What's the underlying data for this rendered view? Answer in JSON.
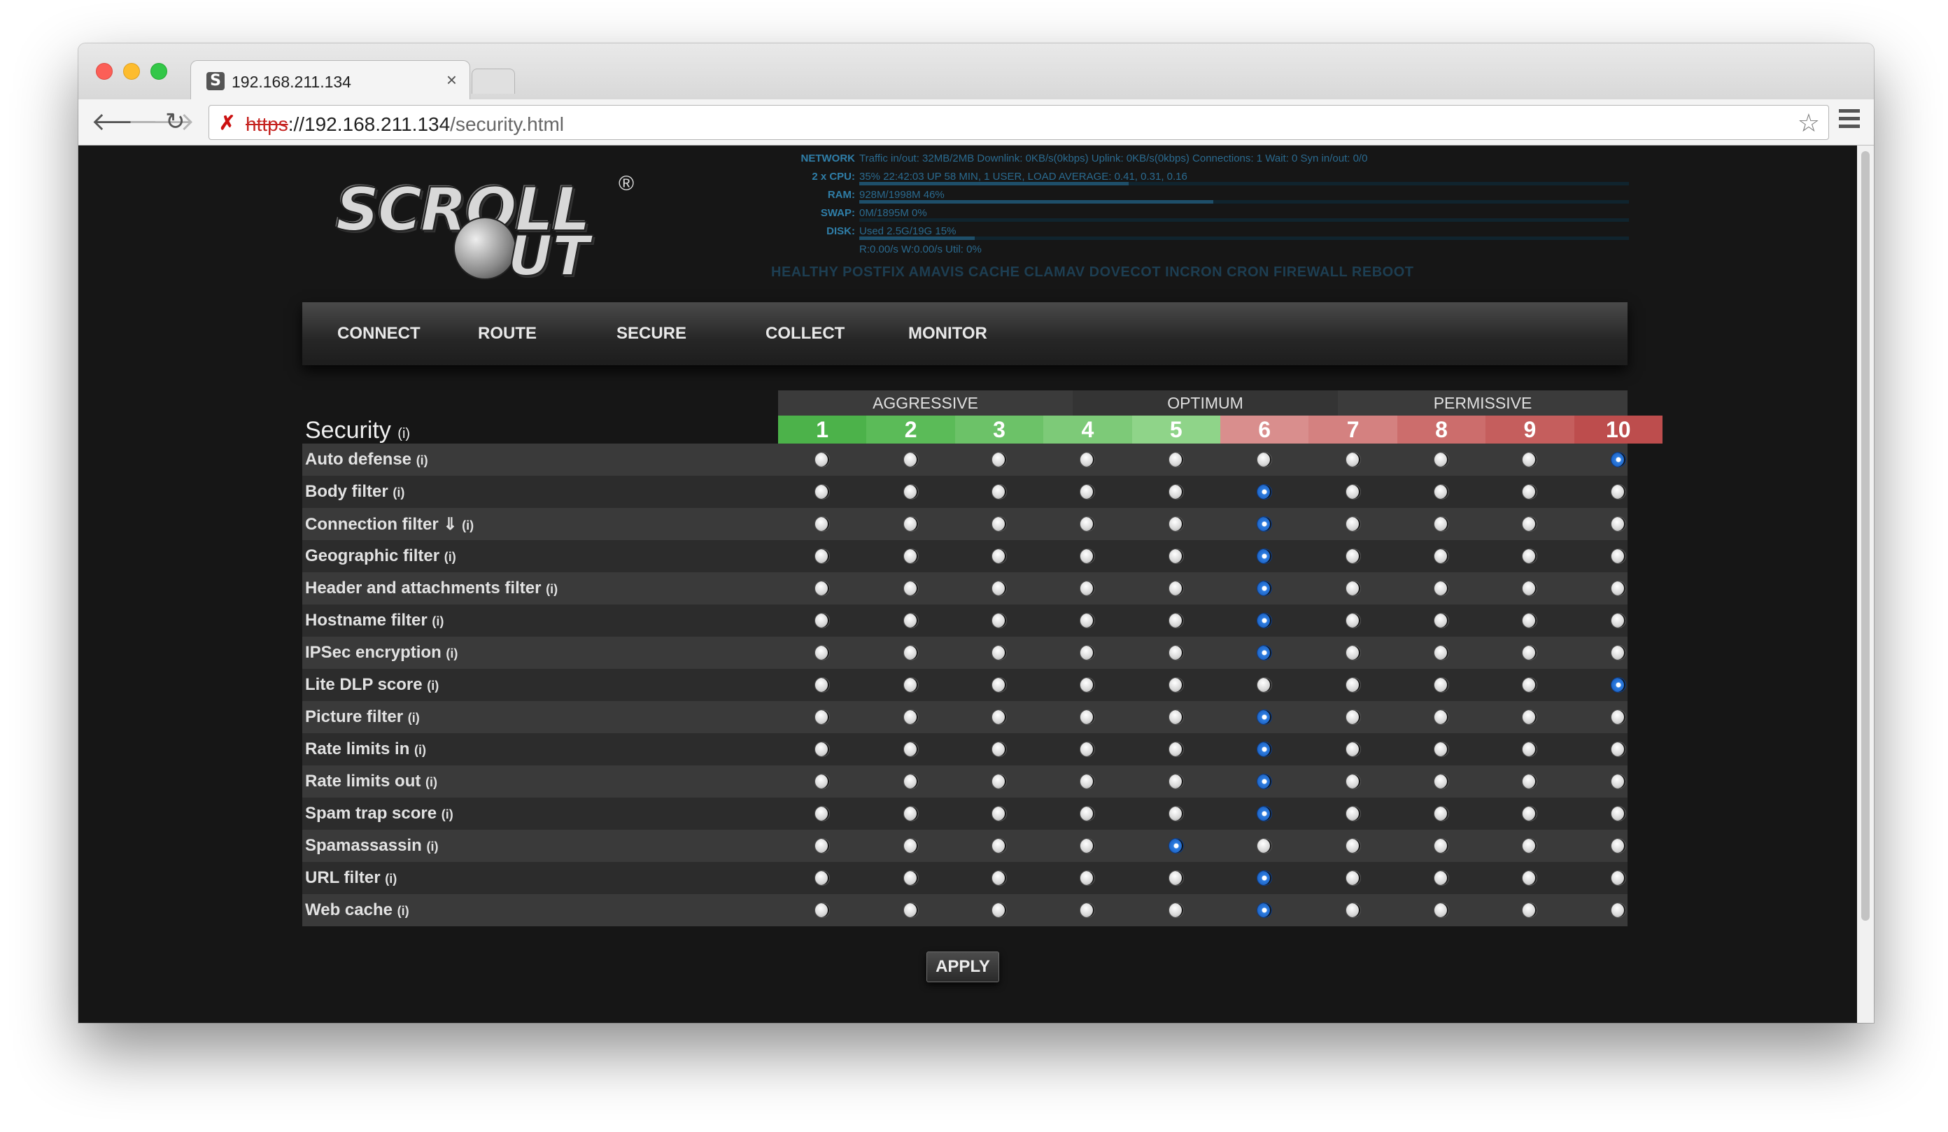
{
  "browser": {
    "tab_title": "192.168.211.134",
    "tab_close": "×",
    "tab_favicon": "S",
    "url_scheme": "https",
    "url_host": "://192.168.211.134",
    "url_path": "/security.html",
    "nav_back": "🡐",
    "nav_forward": "🡒",
    "nav_reload": "↻",
    "insecure_icon": "✗",
    "bookmark_star": "☆"
  },
  "logo": {
    "text1": "SCROLL",
    "text2": "UT",
    "reg": "®"
  },
  "stats": {
    "rows": [
      {
        "label": "NETWORK",
        "value": "Traffic in/out: 32MB/2MB  Downlink: 0KB/s(0kbps)  Uplink: 0KB/s(0kbps)  Connections: 1  Wait: 0  Syn in/out: 0/0",
        "bar": null
      },
      {
        "label": "2 x CPU:",
        "value": "35%   22:42:03 UP 58 MIN, 1 USER, LOAD AVERAGE: 0.41, 0.31, 0.16",
        "bar": 35
      },
      {
        "label": "RAM:",
        "value": "928M/1998M 46%",
        "bar": 46
      },
      {
        "label": "SWAP:",
        "value": "0M/1895M 0%",
        "bar": 0
      },
      {
        "label": "DISK:",
        "value": "Used 2.5G/19G 15%",
        "bar": 15
      },
      {
        "label": "",
        "value": "R:0.00/s W:0.00/s Util: 0%",
        "bar": 0
      }
    ],
    "services": "HEALTHY  POSTFIX AMAVIS CACHE CLAMAV DOVECOT INCRON CRON FIREWALL REBOOT"
  },
  "nav": [
    "CONNECT",
    "ROUTE",
    "SECURE",
    "COLLECT",
    "MONITOR"
  ],
  "security": {
    "title": "Security",
    "info": "(i)",
    "groups": [
      {
        "label": "AGGRESSIVE"
      },
      {
        "label": "OPTIMUM"
      },
      {
        "label": "PERMISSIVE"
      }
    ],
    "levels": [
      {
        "label": "1",
        "color": "#4cb24a"
      },
      {
        "label": "2",
        "color": "#5bbb58"
      },
      {
        "label": "3",
        "color": "#6cc268"
      },
      {
        "label": "4",
        "color": "#7dca78"
      },
      {
        "label": "5",
        "color": "#8fd489"
      },
      {
        "label": "6",
        "color": "#d98e8d"
      },
      {
        "label": "7",
        "color": "#d48180"
      },
      {
        "label": "8",
        "color": "#cc6d6c"
      },
      {
        "label": "9",
        "color": "#c55e5d"
      },
      {
        "label": "10",
        "color": "#bd4d4d"
      }
    ],
    "rows": [
      {
        "label": "Auto defense",
        "selected": 10
      },
      {
        "label": "Body filter",
        "selected": 6
      },
      {
        "label": "Connection filter ⇓",
        "selected": 6
      },
      {
        "label": "Geographic filter",
        "selected": 6
      },
      {
        "label": "Header and attachments filter",
        "selected": 6
      },
      {
        "label": "Hostname filter",
        "selected": 6
      },
      {
        "label": "IPSec encryption",
        "selected": 6
      },
      {
        "label": "Lite DLP score",
        "selected": 10
      },
      {
        "label": "Picture filter",
        "selected": 6
      },
      {
        "label": "Rate limits in",
        "selected": 6
      },
      {
        "label": "Rate limits out",
        "selected": 6
      },
      {
        "label": "Spam trap score",
        "selected": 6
      },
      {
        "label": "Spamassassin",
        "selected": 5
      },
      {
        "label": "URL filter",
        "selected": 6
      },
      {
        "label": "Web cache",
        "selected": 6
      }
    ],
    "apply_label": "APPLY"
  }
}
